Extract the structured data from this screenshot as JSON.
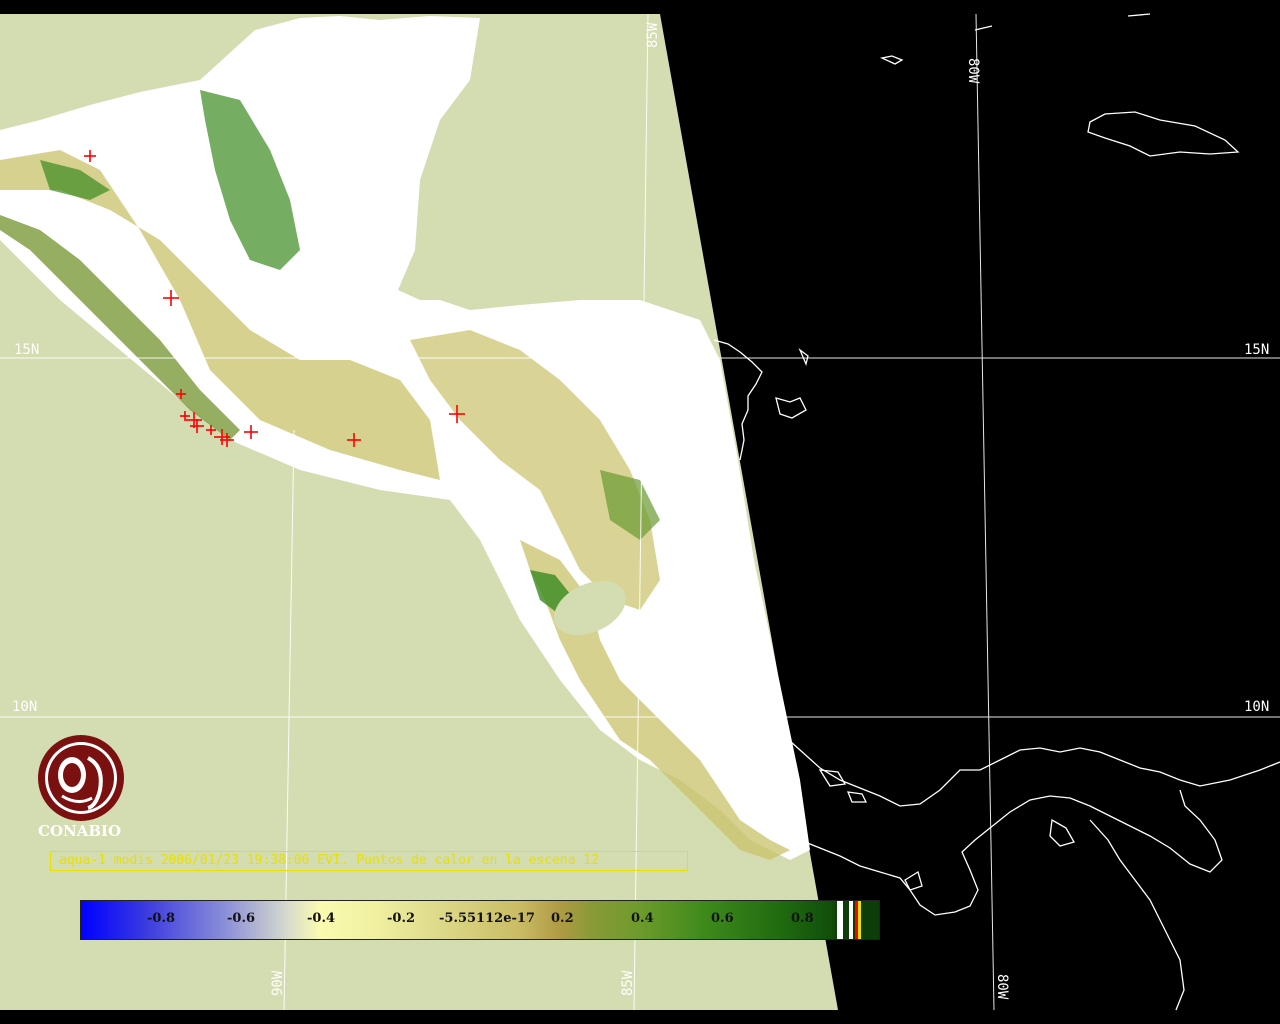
{
  "map": {
    "lat_labels": [
      "15N",
      "15N",
      "10N",
      "10N"
    ],
    "lon_labels_top": [
      "85W",
      "80W"
    ],
    "lon_labels_bottom": [
      "90W",
      "85W",
      "80W"
    ],
    "colors": {
      "ocean_in_swath": "#d4dcb2",
      "outside_swath": "#000000",
      "cloud": "#ffffff",
      "vegetation_dark": "#2e7a1a",
      "vegetation_light": "#c9c26a",
      "coastline": "#ffffff",
      "hotspot": "#ff0000"
    },
    "hotspot_count": 12
  },
  "logo": {
    "name": "CONABIO"
  },
  "caption": "aqua-1 modis 2006/01/23 19:38:06 EVI. Puntos de calor en la escena 12",
  "colorbar": {
    "ticks": [
      "-0.8",
      "-0.6",
      "-0.4",
      "-0.2",
      "-5.55112e-17",
      "0.2",
      "0.4",
      "0.6",
      "0.8"
    ]
  }
}
